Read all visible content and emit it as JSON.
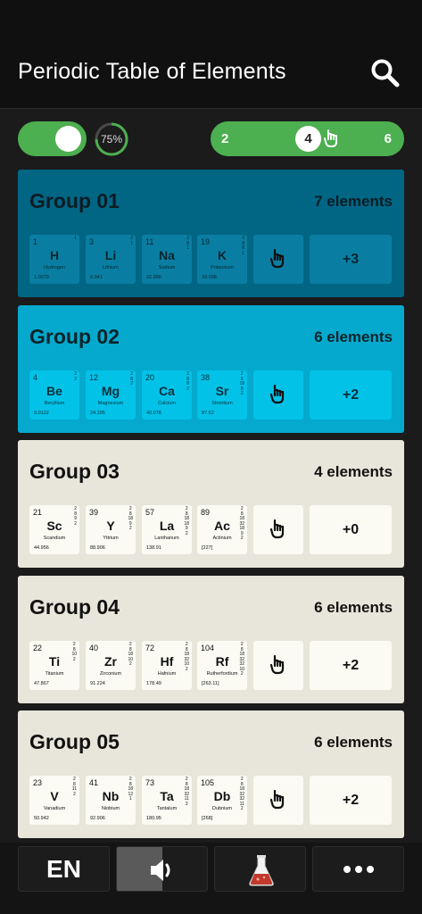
{
  "header": {
    "title": "Periodic Table of Elements",
    "search_icon": "search-icon"
  },
  "controls": {
    "toggle_on": true,
    "zoom_label": "75%",
    "zoom_fraction": 0.75,
    "segment_options": [
      "2",
      "4",
      "6"
    ],
    "segment_selected": "4",
    "accent": "#4caf50"
  },
  "groups": [
    {
      "name": "Group 01",
      "count_label": "7 elements",
      "more_label": "+3",
      "elements": [
        {
          "num": "1",
          "sym": "H",
          "name": "Hydrogen",
          "mass": "1.0079",
          "shells": [
            "1"
          ]
        },
        {
          "num": "3",
          "sym": "Li",
          "name": "Lithium",
          "mass": "6.941",
          "shells": [
            "2",
            "1"
          ]
        },
        {
          "num": "11",
          "sym": "Na",
          "name": "Sodium",
          "mass": "22.990",
          "shells": [
            "2",
            "8",
            "1"
          ]
        },
        {
          "num": "19",
          "sym": "K",
          "name": "Potassium",
          "mass": "39.098",
          "shells": [
            "2",
            "8",
            "8",
            "1"
          ]
        }
      ]
    },
    {
      "name": "Group 02",
      "count_label": "6 elements",
      "more_label": "+2",
      "elements": [
        {
          "num": "4",
          "sym": "Be",
          "name": "Beryllium",
          "mass": "9.0122",
          "shells": [
            "2",
            "2"
          ]
        },
        {
          "num": "12",
          "sym": "Mg",
          "name": "Magnesium",
          "mass": "24.305",
          "shells": [
            "2",
            "8",
            "2"
          ]
        },
        {
          "num": "20",
          "sym": "Ca",
          "name": "Calcium",
          "mass": "40.078",
          "shells": [
            "2",
            "8",
            "8",
            "2"
          ]
        },
        {
          "num": "38",
          "sym": "Sr",
          "name": "Strontium",
          "mass": "87.62",
          "shells": [
            "2",
            "8",
            "18",
            "8",
            "2"
          ]
        }
      ]
    },
    {
      "name": "Group 03",
      "count_label": "4 elements",
      "more_label": "+0",
      "elements": [
        {
          "num": "21",
          "sym": "Sc",
          "name": "Scandium",
          "mass": "44.956",
          "shells": [
            "2",
            "8",
            "9",
            "2"
          ]
        },
        {
          "num": "39",
          "sym": "Y",
          "name": "Yttrium",
          "mass": "88.906",
          "shells": [
            "2",
            "8",
            "18",
            "9",
            "2"
          ]
        },
        {
          "num": "57",
          "sym": "La",
          "name": "Lanthanum",
          "mass": "138.91",
          "shells": [
            "2",
            "8",
            "18",
            "18",
            "9",
            "2"
          ]
        },
        {
          "num": "89",
          "sym": "Ac",
          "name": "Actinium",
          "mass": "[227]",
          "shells": [
            "2",
            "8",
            "18",
            "32",
            "18",
            "9",
            "2"
          ]
        }
      ]
    },
    {
      "name": "Group 04",
      "count_label": "6 elements",
      "more_label": "+2",
      "elements": [
        {
          "num": "22",
          "sym": "Ti",
          "name": "Titanium",
          "mass": "47.867",
          "shells": [
            "2",
            "8",
            "10",
            "2"
          ]
        },
        {
          "num": "40",
          "sym": "Zr",
          "name": "Zirconium",
          "mass": "91.224",
          "shells": [
            "2",
            "8",
            "18",
            "10",
            "2"
          ]
        },
        {
          "num": "72",
          "sym": "Hf",
          "name": "Hafnium",
          "mass": "178.49",
          "shells": [
            "2",
            "8",
            "18",
            "32",
            "10",
            "2"
          ]
        },
        {
          "num": "104",
          "sym": "Rf",
          "name": "Rutherfordium",
          "mass": "[263.11]",
          "shells": [
            "2",
            "8",
            "18",
            "32",
            "32",
            "10",
            "2"
          ]
        }
      ]
    },
    {
      "name": "Group 05",
      "count_label": "6 elements",
      "more_label": "+2",
      "elements": [
        {
          "num": "23",
          "sym": "V",
          "name": "Vanadium",
          "mass": "50.942",
          "shells": [
            "2",
            "8",
            "11",
            "2"
          ]
        },
        {
          "num": "41",
          "sym": "Nb",
          "name": "Niobium",
          "mass": "92.906",
          "shells": [
            "2",
            "8",
            "18",
            "12",
            "1"
          ]
        },
        {
          "num": "73",
          "sym": "Ta",
          "name": "Tantalum",
          "mass": "180.95",
          "shells": [
            "2",
            "8",
            "18",
            "32",
            "11",
            "2"
          ]
        },
        {
          "num": "105",
          "sym": "Db",
          "name": "Dubnium",
          "mass": "[268]",
          "shells": [
            "2",
            "8",
            "18",
            "32",
            "32",
            "11",
            "2"
          ]
        }
      ]
    }
  ],
  "bottom_bar": {
    "language_label": "EN",
    "sound_icon": "speaker-icon",
    "lab_icon": "flask-icon",
    "more_icon": "more-dots-icon"
  }
}
